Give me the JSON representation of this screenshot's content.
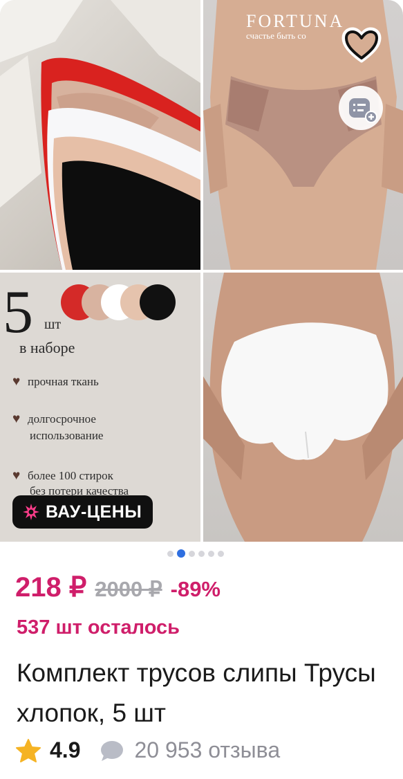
{
  "gallery": {
    "brand_name": "FORTUNA",
    "brand_tagline": "счастье быть со",
    "promo": {
      "big_number": "5",
      "unit": "шт",
      "set_text": "в наборе",
      "features": [
        {
          "line1": "прочная ткань",
          "line2": ""
        },
        {
          "line1": "долгосрочное",
          "line2": "использование"
        },
        {
          "line1": "более 100 стирок",
          "line2": "без потери качества"
        }
      ],
      "color_swatches": [
        "#d42a28",
        "#d8b3a0",
        "#ffffff",
        "#e5c3ad",
        "#111111"
      ]
    },
    "badge_label": "ВАУ-ЦЕНЫ",
    "slides_count": 6,
    "active_slide": 1
  },
  "product": {
    "price": "218 ₽",
    "old_price": "2000 ₽",
    "discount": "-89%",
    "stock": "537 шт осталось",
    "title": "Комплект трусов слипы Трусы хлопок, 5 шт",
    "rating": "4.9",
    "reviews": "20 953 отзыва"
  },
  "colors": {
    "accent": "#cf1e6a",
    "dot_active": "#2f6fe0",
    "star": "#f5b324",
    "badge_bg": "#101010"
  },
  "icons": [
    "heart-icon",
    "compare-list-icon",
    "sparkle-icon",
    "star-icon",
    "comment-icon"
  ]
}
